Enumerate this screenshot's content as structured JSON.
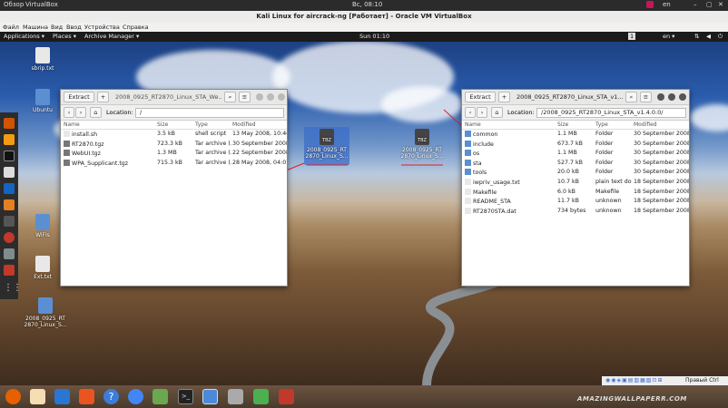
{
  "host_bar": {
    "overview": "Обзор",
    "app": "VirtualBox",
    "clock": "Вс, 08:10",
    "lang": "en"
  },
  "vbox": {
    "title": "Kali Linux for aircrack-ng  [Работает] - Oracle VM VirtualBox",
    "menu": [
      "Файл",
      "Машина",
      "Вид",
      "Ввод",
      "Устройства",
      "Справка"
    ],
    "status_text": "Правый Ctrl"
  },
  "gnome_bar": {
    "applications": "Applications ▾",
    "places": "Places ▾",
    "archive": "Archive Manager ▾",
    "clock": "Sun 01:10",
    "workspace": "1",
    "lang": "en ▾"
  },
  "desktop_icons": [
    {
      "label": "sbrip.txt",
      "kind": "file"
    },
    {
      "label": "Ubuntu",
      "kind": "folder"
    },
    {
      "label": "WiFIs",
      "kind": "folder"
    },
    {
      "label": "Ext.txt",
      "kind": "file"
    },
    {
      "label": "2008_0925_RT 2870_Linux_S...",
      "kind": "folder"
    },
    {
      "label": "2008_0925_RT 2870_Linux_S...",
      "kind": "archive",
      "badge": "TBZ"
    },
    {
      "label": "2008_0925_RT 2870_Linux_S...",
      "kind": "archive",
      "badge": "TBZ"
    }
  ],
  "archive_window": {
    "extract": "Extract",
    "add": "+",
    "title": "2008_0925_RT2870_Linux_STA_We...",
    "location_label": "Location:",
    "location": "/",
    "columns": [
      "Name",
      "Size",
      "Type",
      "Modified"
    ],
    "rows": [
      [
        "install.sh",
        "3.5 kB",
        "shell script",
        "13 May 2008, 10:40"
      ],
      [
        "RT2870.tgz",
        "723.3 kB",
        "Tar archive (...",
        "30 September 2008..."
      ],
      [
        "WebUI.tgz",
        "1.3 MB",
        "Tar archive (...",
        "22 September 2008..."
      ],
      [
        "WPA_Supplicant.tgz",
        "715.3 kB",
        "Tar archive (...",
        "28 May 2008, 04:07"
      ]
    ]
  },
  "folder_window": {
    "extract": "Extract",
    "add": "+",
    "title": "2008_0925_RT2870_Linux_STA_v1...",
    "location_label": "Location:",
    "location": "/2008_0925_RT2870_Linux_STA_v1.4.0.0/",
    "columns": [
      "Name",
      "Size",
      "Type",
      "Modified"
    ],
    "rows": [
      [
        "common",
        "1.1 MB",
        "Folder",
        "30 September 2008..."
      ],
      [
        "include",
        "673.7 kB",
        "Folder",
        "30 September 2008..."
      ],
      [
        "os",
        "1.1 MB",
        "Folder",
        "30 September 2008..."
      ],
      [
        "sta",
        "527.7 kB",
        "Folder",
        "30 September 2008..."
      ],
      [
        "tools",
        "20.0 kB",
        "Folder",
        "30 September 2008..."
      ],
      [
        "iwpriv_usage.txt",
        "10.7 kB",
        "plain text do...",
        "18 September 2008..."
      ],
      [
        "Makefile",
        "6.0 kB",
        "Makefile",
        "18 September 2008..."
      ],
      [
        "README_STA",
        "11.7 kB",
        "unknown",
        "18 September 2008..."
      ],
      [
        "RT2870STA.dat",
        "734 bytes",
        "unknown",
        "18 September 2008..."
      ]
    ]
  },
  "watermark": "AMAZINGWALLPAPERR.COM",
  "colors": {
    "accent": "#3d6fc9",
    "arrow": "#e02020",
    "dock": "#2c2c2c"
  }
}
